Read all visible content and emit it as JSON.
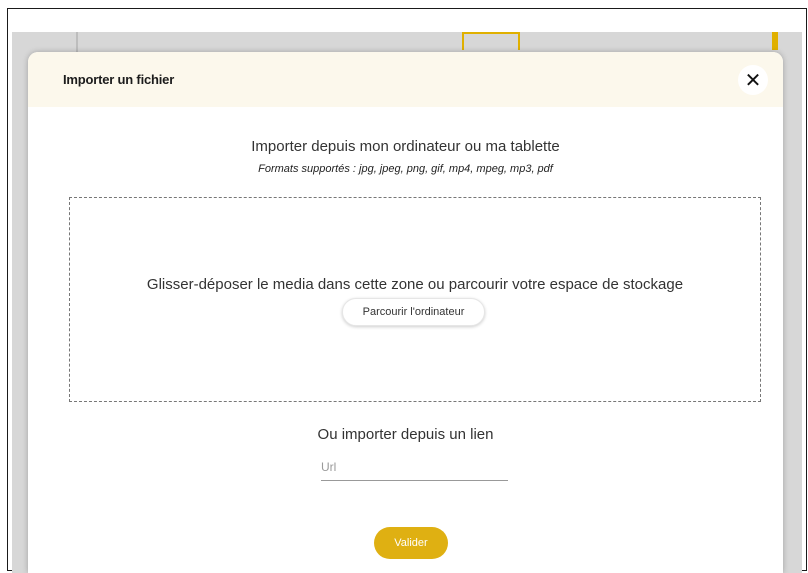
{
  "modal": {
    "title": "Importer un fichier",
    "close_icon": "close-icon",
    "close_symbol": "✕"
  },
  "upload": {
    "heading": "Importer depuis mon ordinateur ou ma tablette",
    "formats": "Formats supportés : jpg, jpeg, png, gif, mp4, mpeg, mp3, pdf",
    "dropzone_text": "Glisser-déposer le media dans cette zone ou parcourir votre espace de stockage",
    "browse_label": "Parcourir l'ordinateur"
  },
  "link": {
    "heading": "Ou importer depuis un lien",
    "url_placeholder": "Url",
    "url_value": ""
  },
  "actions": {
    "validate_label": "Valider"
  },
  "colors": {
    "accent": "#dfb012",
    "header_bg": "#fcf8ec",
    "overlay": "#d7d7d7"
  }
}
